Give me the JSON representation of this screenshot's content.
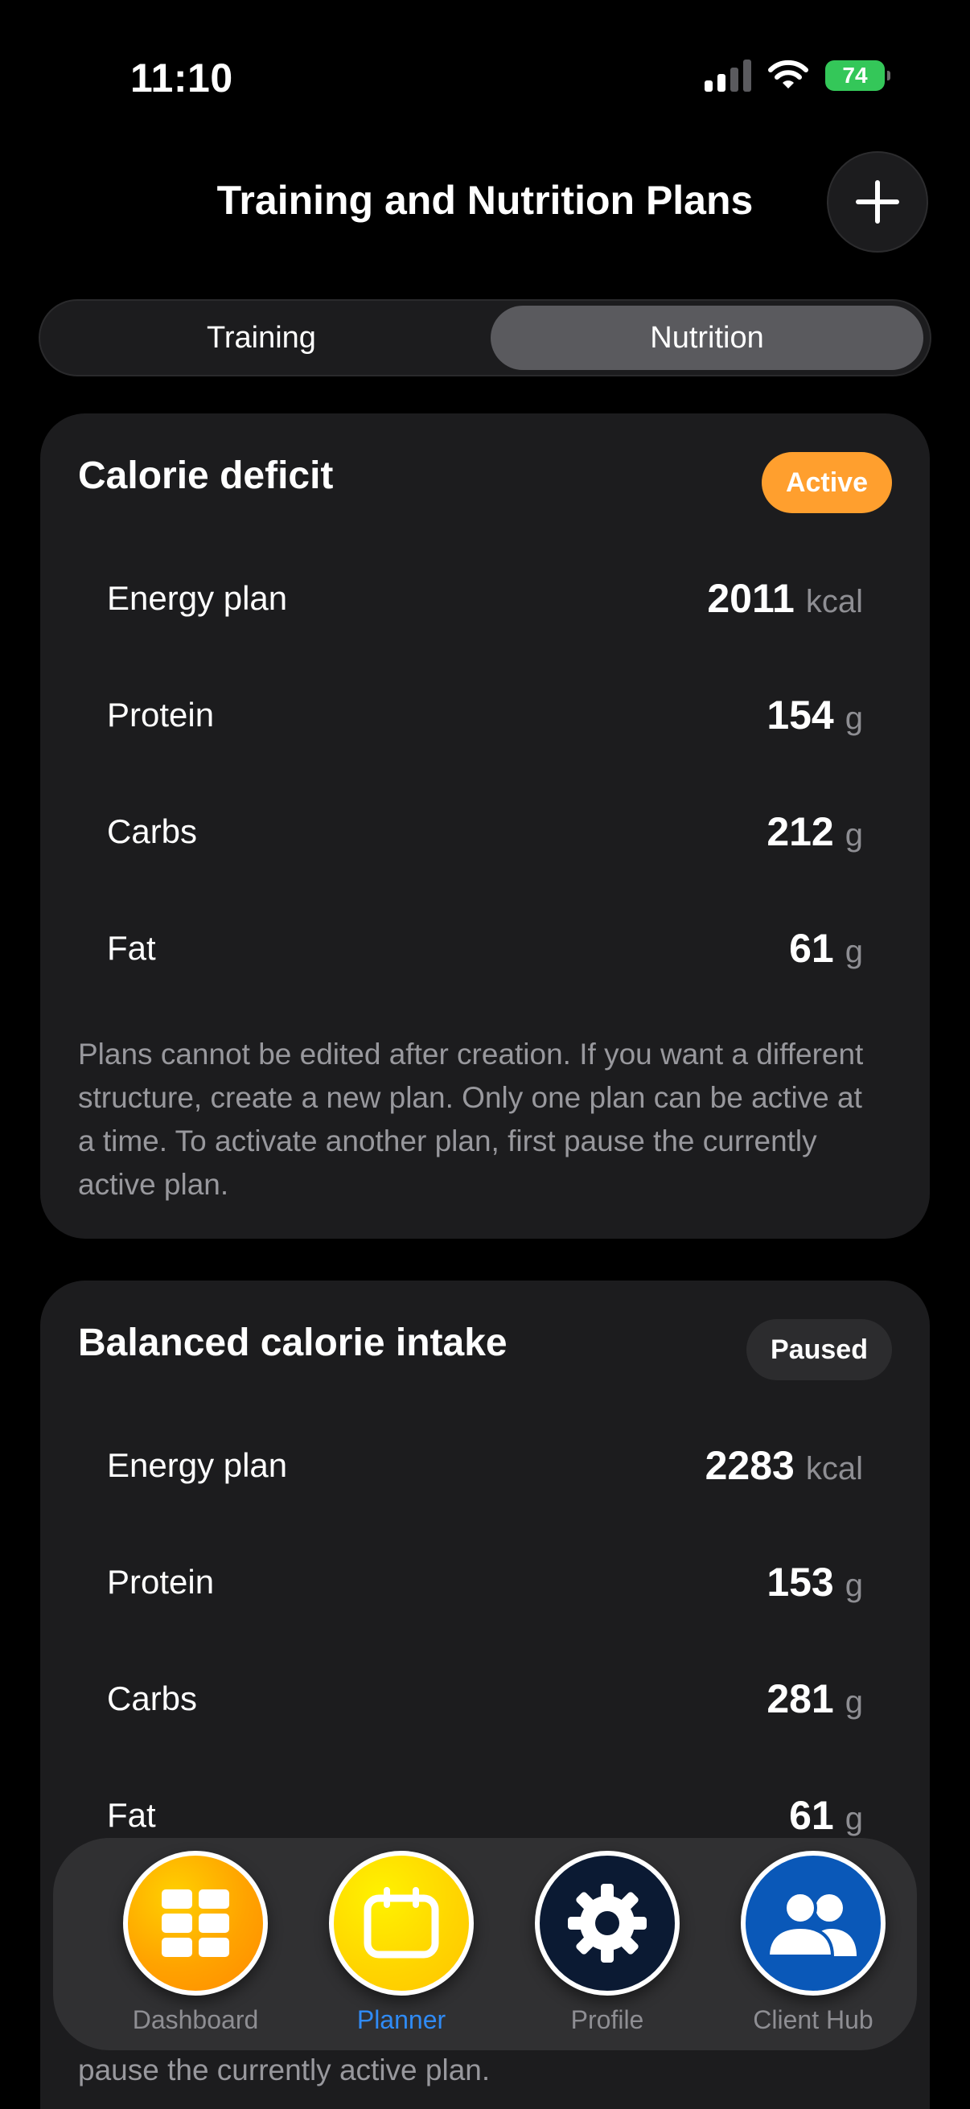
{
  "status_bar": {
    "time": "11:10",
    "battery": "74"
  },
  "header": {
    "title": "Training and Nutrition Plans",
    "add_icon": "plus-icon"
  },
  "segments": {
    "training": "Training",
    "nutrition": "Nutrition",
    "selected": "Nutrition"
  },
  "colors": {
    "active_badge": "#ff9f2e",
    "paused_badge": "#2c2c2e",
    "accent_blue": "#2f8bf6",
    "card_bg": "#1c1c1e"
  },
  "plans": [
    {
      "title": "Calorie deficit",
      "status": "Active",
      "rows": [
        {
          "label": "Energy plan",
          "value": "2011",
          "unit": "kcal"
        },
        {
          "label": "Protein",
          "value": "154",
          "unit": "g"
        },
        {
          "label": "Carbs",
          "value": "212",
          "unit": "g"
        },
        {
          "label": "Fat",
          "value": "61",
          "unit": "g"
        }
      ],
      "note": "Plans cannot be edited after creation. If you want a different structure, create a new plan. Only one plan can be active at a time. To activate another plan, first pause the currently active plan."
    },
    {
      "title": "Balanced calorie intake",
      "status": "Paused",
      "rows": [
        {
          "label": "Energy plan",
          "value": "2283",
          "unit": "kcal"
        },
        {
          "label": "Protein",
          "value": "153",
          "unit": "g"
        },
        {
          "label": "Carbs",
          "value": "281",
          "unit": "g"
        },
        {
          "label": "Fat",
          "value": "61",
          "unit": "g"
        }
      ],
      "note": "pause the currently active plan."
    }
  ],
  "tab_bar": {
    "tabs": [
      {
        "label": "Dashboard",
        "icon": "grid-icon"
      },
      {
        "label": "Planner",
        "icon": "calendar-icon",
        "active": true
      },
      {
        "label": "Profile",
        "icon": "gear-icon"
      },
      {
        "label": "Client Hub",
        "icon": "people-icon"
      }
    ]
  }
}
